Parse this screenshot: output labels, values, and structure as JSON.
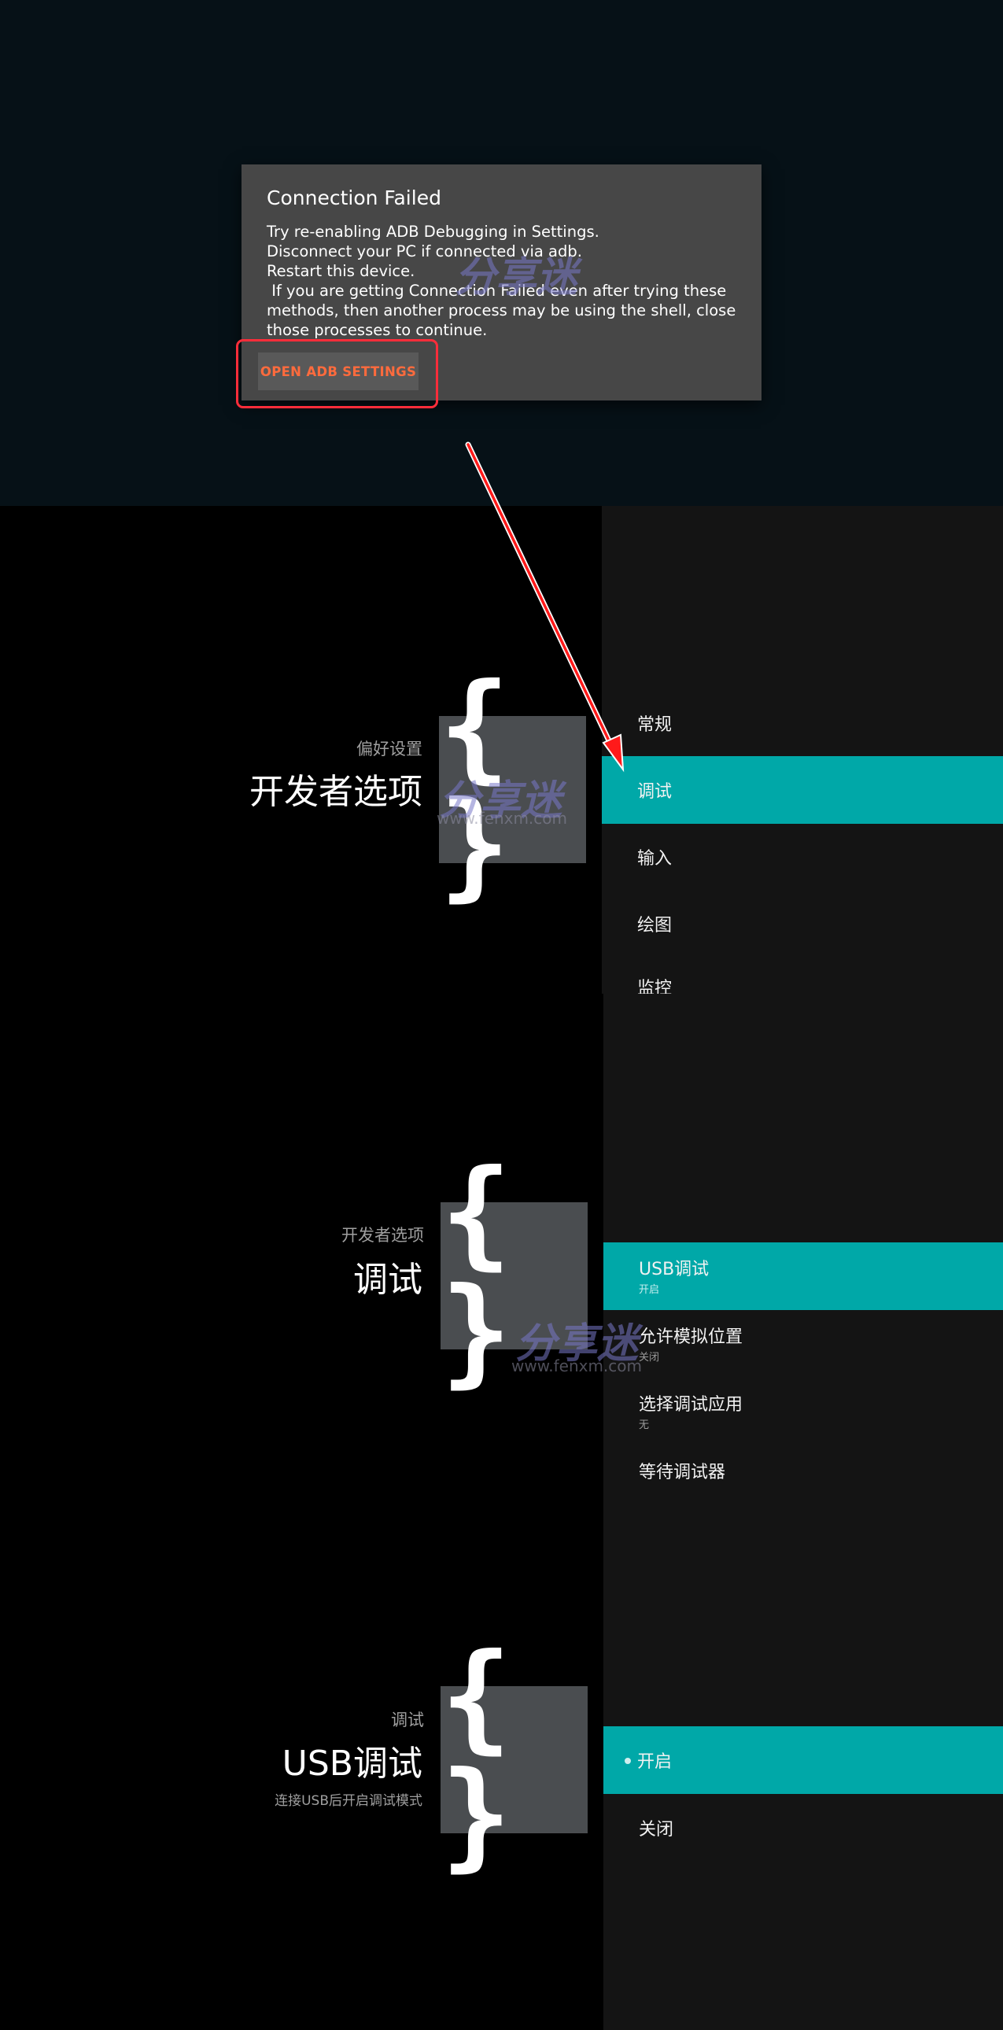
{
  "dialog": {
    "title": "Connection Failed",
    "lines": [
      "Try re-enabling ADB Debugging in Settings.",
      "Disconnect your PC if connected via adb.",
      "Restart this device.",
      " If you are getting Connection Failed even after trying these",
      "methods, then another process may be using the shell, close",
      "those processes to continue."
    ],
    "button_label": "OPEN ADB SETTINGS"
  },
  "screen1": {
    "breadcrumb": "偏好设置",
    "title": "开发者选项",
    "menu": [
      {
        "label": "常规",
        "selected": false
      },
      {
        "label": "调试",
        "selected": true
      },
      {
        "label": "输入",
        "selected": false
      },
      {
        "label": "绘图",
        "selected": false
      },
      {
        "label": "监控",
        "selected": false
      }
    ]
  },
  "screen2": {
    "breadcrumb": "开发者选项",
    "title": "调试",
    "menu": [
      {
        "label": "USB调试",
        "sub": "开启",
        "selected": true
      },
      {
        "label": "允许模拟位置",
        "sub": "关闭",
        "selected": false
      },
      {
        "label": "选择调试应用",
        "sub": "无",
        "selected": false
      },
      {
        "label": "等待调试器",
        "sub": "",
        "selected": false
      }
    ]
  },
  "screen3": {
    "breadcrumb": "调试",
    "title": "USB调试",
    "description": "连接USB后开启调试模式",
    "menu": [
      {
        "label": "开启",
        "selected": true
      },
      {
        "label": "关闭",
        "selected": false
      }
    ]
  },
  "icons": {
    "brace_tile": "{ }"
  },
  "watermark": {
    "text": "分享迷",
    "url": "www.fenxm.com"
  },
  "colors": {
    "accent_teal": "#00a8a8",
    "button_text": "#ff6b3d",
    "highlight_red": "#ff2d3a"
  }
}
